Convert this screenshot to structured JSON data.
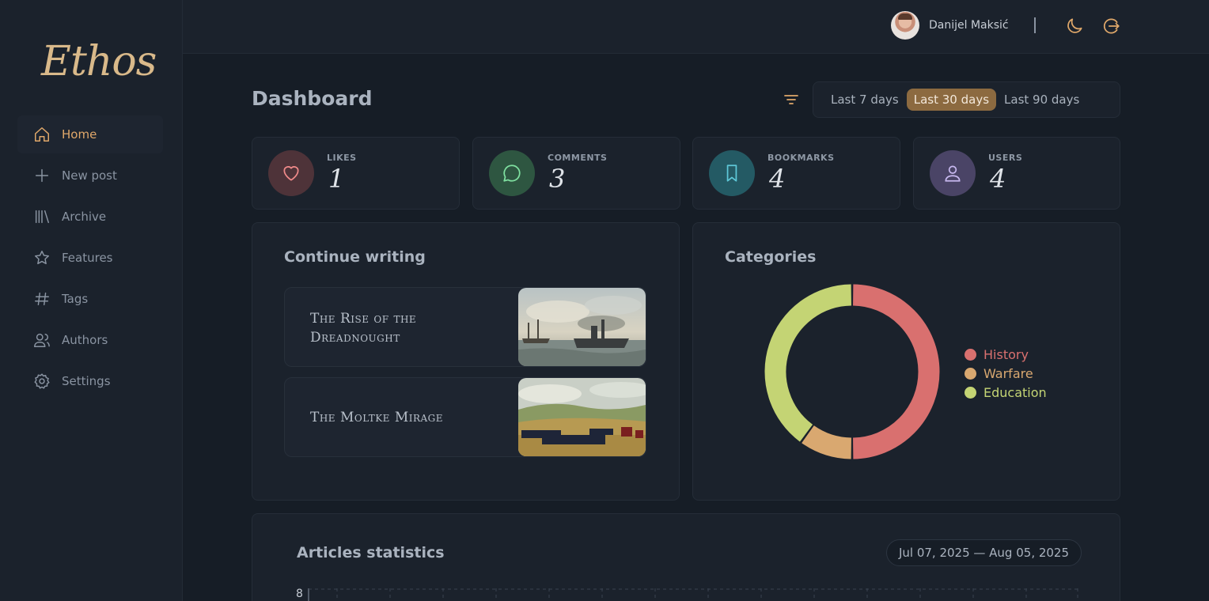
{
  "app": {
    "logo": "Ethos"
  },
  "sidebar": {
    "items": [
      {
        "label": "Home",
        "icon": "home-icon",
        "active": true
      },
      {
        "label": "New post",
        "icon": "plus-icon",
        "active": false
      },
      {
        "label": "Archive",
        "icon": "archive-icon",
        "active": false
      },
      {
        "label": "Features",
        "icon": "star-icon",
        "active": false
      },
      {
        "label": "Tags",
        "icon": "hash-icon",
        "active": false
      },
      {
        "label": "Authors",
        "icon": "users-icon",
        "active": false
      },
      {
        "label": "Settings",
        "icon": "gear-icon",
        "active": false
      }
    ]
  },
  "topbar": {
    "user_name": "Danijel Maksić",
    "separator": "|",
    "icons": [
      "moon-icon",
      "logout-icon"
    ]
  },
  "header": {
    "title": "Dashboard",
    "ranges": [
      "Last 7 days",
      "Last 30 days",
      "Last 90 days"
    ],
    "active_range": "Last 30 days"
  },
  "stats": [
    {
      "label": "LIKES",
      "value": "1",
      "icon": "heart-icon",
      "color": "#f08a8a",
      "bg": "#4e3339"
    },
    {
      "label": "COMMENTS",
      "value": "3",
      "icon": "chat-icon",
      "color": "#7fe0a0",
      "bg": "#2e5641"
    },
    {
      "label": "BOOKMARKS",
      "value": "4",
      "icon": "bookmark-icon",
      "color": "#5ec8d8",
      "bg": "#245a64"
    },
    {
      "label": "USERS",
      "value": "4",
      "icon": "user-icon",
      "color": "#c7b8ef",
      "bg": "#4a4466"
    }
  ],
  "continue_writing": {
    "title": "Continue writing",
    "posts": [
      {
        "title": "The Rise of the Dreadnought",
        "image": "battleship-painting"
      },
      {
        "title": "The Moltke Mirage",
        "image": "battlefield-painting"
      }
    ]
  },
  "categories": {
    "title": "Categories",
    "items": [
      {
        "name": "History",
        "color": "#d9706f"
      },
      {
        "name": "Warfare",
        "color": "#d9a870"
      },
      {
        "name": "Education",
        "color": "#c4d474"
      }
    ]
  },
  "chart_data": {
    "type": "pie",
    "categories": [
      "History",
      "Warfare",
      "Education"
    ],
    "values": [
      50,
      10,
      40
    ],
    "colors": [
      "#d9706f",
      "#d9a870",
      "#c4d474"
    ],
    "title": "Categories",
    "legend": "right"
  },
  "statistics": {
    "title": "Articles statistics",
    "date_range": "Jul 07, 2025 — Aug 05, 2025",
    "y_top_tick": "8"
  }
}
